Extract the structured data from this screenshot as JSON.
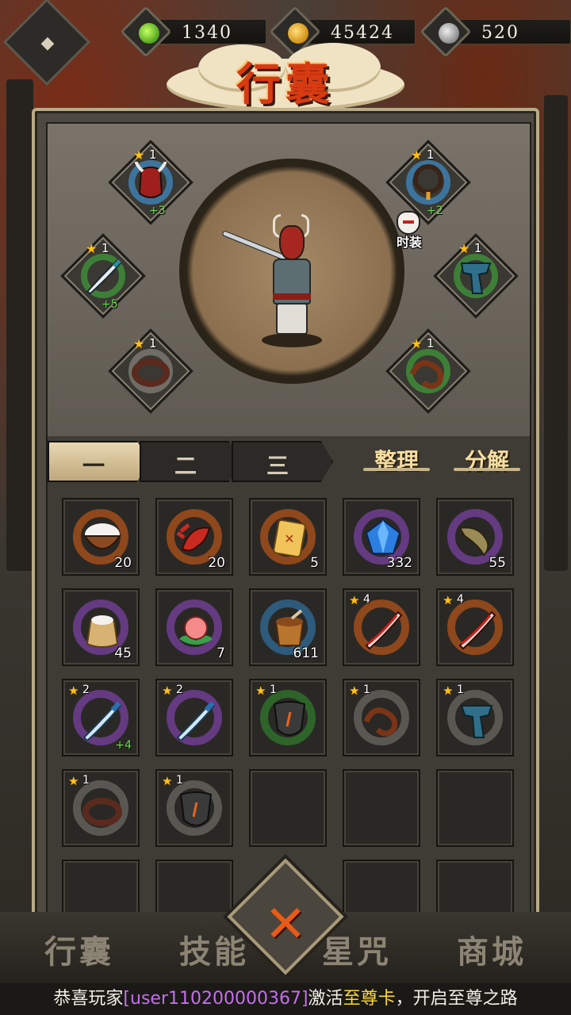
{
  "resources": {
    "jade": "1340",
    "coins": "45424",
    "silver": "520"
  },
  "title": "行囊",
  "fashion_label": "时装",
  "equipment": {
    "head": {
      "stars": "1",
      "bonus": "+3"
    },
    "necklace": {
      "stars": "1",
      "bonus": "+2"
    },
    "weapon": {
      "stars": "1",
      "bonus": "+5"
    },
    "scarf": {
      "stars": "1"
    },
    "bracelet": {
      "stars": "1"
    },
    "belt": {
      "stars": "1"
    }
  },
  "tabs": [
    "一",
    "二",
    "三"
  ],
  "actions": {
    "sort": "整理",
    "decompose": "分解"
  },
  "inventory": [
    {
      "item": "rice-bowl",
      "count": "20"
    },
    {
      "item": "lobster",
      "count": "20"
    },
    {
      "item": "scroll",
      "count": "5"
    },
    {
      "item": "blue-gem",
      "count": "332"
    },
    {
      "item": "fish",
      "count": "55"
    },
    {
      "item": "rice-sack",
      "count": "45"
    },
    {
      "item": "peach",
      "count": "7"
    },
    {
      "item": "wooden-bucket",
      "count": "611"
    },
    {
      "item": "red-blade",
      "stars": "4"
    },
    {
      "item": "red-blade",
      "stars": "4"
    },
    {
      "item": "ice-sword",
      "stars": "2",
      "bonus": "+4"
    },
    {
      "item": "ice-sword",
      "stars": "2"
    },
    {
      "item": "dark-mask",
      "stars": "1"
    },
    {
      "item": "leather-belt",
      "stars": "1"
    },
    {
      "item": "blue-scarf",
      "stars": "1"
    },
    {
      "item": "bracelet",
      "stars": "1"
    },
    {
      "item": "dark-mask",
      "stars": "1"
    }
  ],
  "bottom_nav": [
    "行囊",
    "技能",
    "星咒",
    "商城"
  ],
  "broadcast": {
    "prefix": "恭喜玩家",
    "user": "[user110200000367]",
    "middle": "激活",
    "vip": "至尊卡",
    "suffix": "，开启至尊之路"
  },
  "colors": {
    "title": "#d83a12",
    "close": "#e85a18",
    "star": "#ffc21a",
    "bonus": "#6de04a",
    "username": "#c56ef0",
    "vip": "#ffd93b"
  }
}
